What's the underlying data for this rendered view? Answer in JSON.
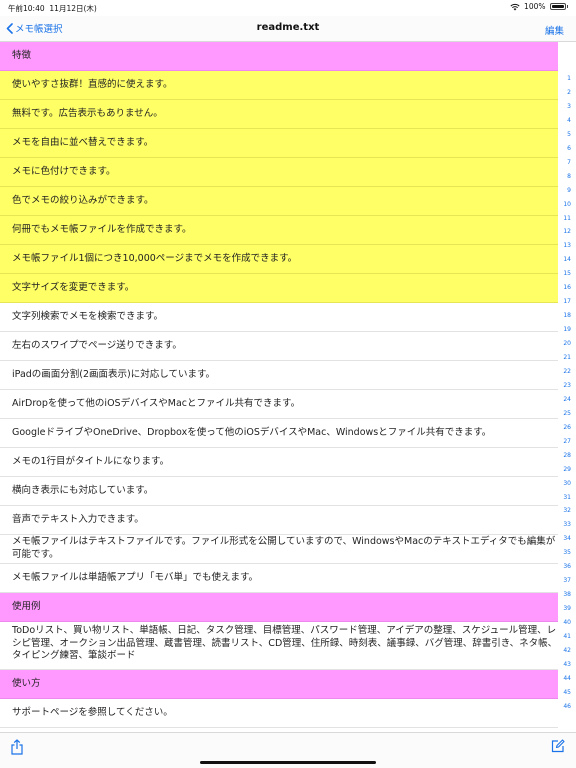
{
  "status_bar": {
    "time": "午前10:40",
    "date": "11月12日(木)",
    "battery": "100%"
  },
  "nav": {
    "back_label": "メモ帳選択",
    "title": "readme.txt",
    "edit_label": "編集"
  },
  "rows": [
    {
      "text": "特徴",
      "color": "pink"
    },
    {
      "text": "使いやすさ抜群！直感的に使えます。",
      "color": "yellow"
    },
    {
      "text": "無料です。広告表示もありません。",
      "color": "yellow"
    },
    {
      "text": "メモを自由に並べ替えできます。",
      "color": "yellow"
    },
    {
      "text": "メモに色付けできます。",
      "color": "yellow"
    },
    {
      "text": "色でメモの絞り込みができます。",
      "color": "yellow"
    },
    {
      "text": "何冊でもメモ帳ファイルを作成できます。",
      "color": "yellow"
    },
    {
      "text": "メモ帳ファイル1個につき10,000ページまでメモを作成できます。",
      "color": "yellow"
    },
    {
      "text": "文字サイズを変更できます。",
      "color": "yellow"
    },
    {
      "text": "文字列検索でメモを検索できます。",
      "color": "white"
    },
    {
      "text": "左右のスワイプでページ送りできます。",
      "color": "white"
    },
    {
      "text": "iPadの画面分割(2画面表示)に対応しています。",
      "color": "white"
    },
    {
      "text": "AirDropを使って他のiOSデバイスやMacとファイル共有できます。",
      "color": "white"
    },
    {
      "text": "GoogleドライブやOneDrive、Dropboxを使って他のiOSデバイスやMac、Windowsとファイル共有できます。",
      "color": "white"
    },
    {
      "text": "メモの1行目がタイトルになります。",
      "color": "white"
    },
    {
      "text": "横向き表示にも対応しています。",
      "color": "white"
    },
    {
      "text": "音声でテキスト入力できます。",
      "color": "white"
    },
    {
      "text": "メモ帳ファイルはテキストファイルです。ファイル形式を公開していますので、WindowsやMacのテキストエディタでも編集が可能です。",
      "color": "white"
    },
    {
      "text": "メモ帳ファイルは単語帳アプリ「モバ単」でも使えます。",
      "color": "white"
    },
    {
      "text": "使用例",
      "color": "pink"
    },
    {
      "text": "ToDoリスト、買い物リスト、単語帳、日記、タスク管理、目標管理、パスワード管理、アイデアの整理、スケジュール管理、レシピ管理、オークション出品管理、蔵書管理、読書リスト、CD管理、住所録、時刻表、議事録、バグ管理、辞書引き、ネタ帳、タイピング練習、筆談ボード",
      "color": "white"
    },
    {
      "text": "使い方",
      "color": "pink"
    },
    {
      "text": "サポートページを参照してください。",
      "color": "white"
    }
  ],
  "line_numbers": [
    "1",
    "2",
    "3",
    "4",
    "5",
    "6",
    "7",
    "8",
    "9",
    "10",
    "11",
    "12",
    "13",
    "14",
    "15",
    "16",
    "17",
    "18",
    "19",
    "20",
    "21",
    "22",
    "23",
    "24",
    "25",
    "26",
    "27",
    "28",
    "29",
    "30",
    "31",
    "32",
    "33",
    "34",
    "35",
    "36",
    "37",
    "38",
    "39",
    "40",
    "41",
    "42",
    "43",
    "44",
    "45",
    "46"
  ],
  "colors": {
    "pink": "#ff99ff",
    "yellow": "#ffff66",
    "accent": "#1a73e8"
  },
  "toolbar": {
    "share_icon": "share-icon",
    "compose_icon": "compose-icon"
  }
}
